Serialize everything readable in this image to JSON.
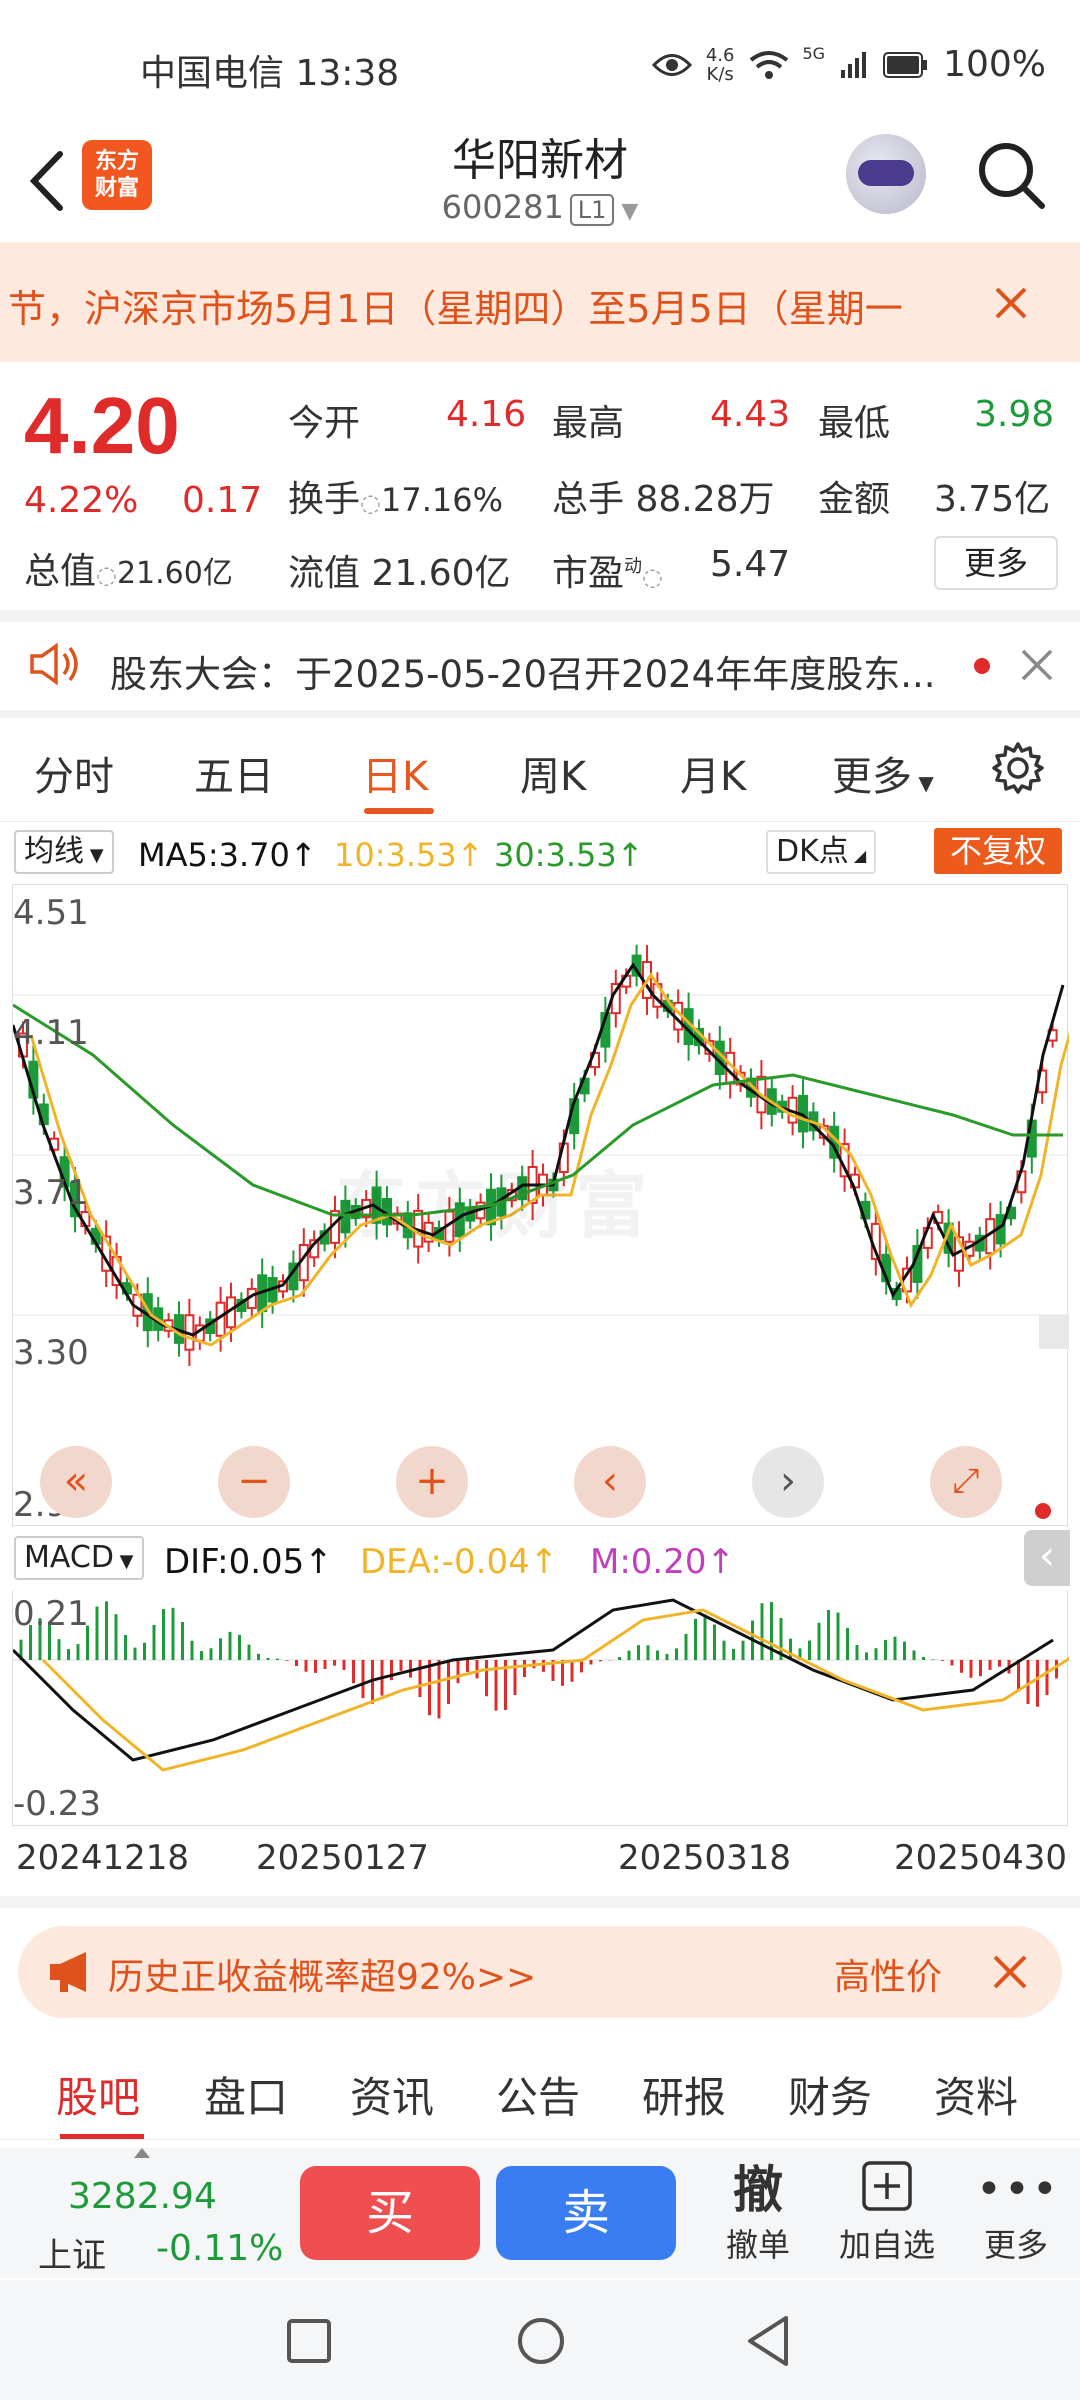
{
  "status_bar": {
    "carrier_time": "中国电信 13:38",
    "net_speed_value": "4.6",
    "net_speed_unit": "K/s",
    "signal": "5G",
    "battery": "100%"
  },
  "header": {
    "logo_text_1": "东方",
    "logo_text_2": "财富",
    "stock_name": "华阳新材",
    "stock_code": "600281",
    "level": "L1"
  },
  "notice": {
    "text": "节，沪深京市场5月1日（星期四）至5月5日（星期一"
  },
  "quote": {
    "price": "4.20",
    "change_pct": "4.22%",
    "change": "0.17",
    "market_value_label": "总值",
    "market_value": "21.60亿",
    "open_label": "今开",
    "open": "4.16",
    "high_label": "最高",
    "high": "4.43",
    "low_label": "最低",
    "low": "3.98",
    "turnover_label": "换手",
    "turnover": "17.16%",
    "volume_label": "总手",
    "volume": "88.28万",
    "amount_label": "金额",
    "amount": "3.75亿",
    "float_label": "流值",
    "float_value": "21.60亿",
    "pe_label": "市盈",
    "pe_sup": "动",
    "pe": "5.47",
    "more": "更多"
  },
  "meeting": {
    "text": "股东大会：于2025-05-20召开2024年年度股东..."
  },
  "tabs": [
    {
      "label": "分时"
    },
    {
      "label": "五日"
    },
    {
      "label": "日K"
    },
    {
      "label": "周K"
    },
    {
      "label": "月K"
    },
    {
      "label": "更多"
    }
  ],
  "indicators": {
    "ma_select": "均线",
    "ma5": "MA5:3.70↑",
    "ma10": "10:3.53↑",
    "ma30": "30:3.53↑",
    "dk": "DK点",
    "adjust": "不复权",
    "macd_select": "MACD",
    "dif": "DIF:0.05↑",
    "dea": "DEA:-0.04↑",
    "m": "M:0.20↑"
  },
  "colors": {
    "up": "#e02b2b",
    "down": "#1d9a3a",
    "ma5": "#111111",
    "ma10": "#f0b429",
    "ma30": "#2a9a2a",
    "accent": "#e8571e"
  },
  "chart_data": {
    "type": "candlestick",
    "y_ticks": [
      "4.51",
      "4.11",
      "3.71",
      "3.30",
      "2.90"
    ],
    "macd_ticks": [
      "0.21",
      "-0.23"
    ],
    "x_ticks": [
      "20241218",
      "20250127",
      "20250318",
      "20250430"
    ],
    "watermark": "东方财富",
    "ylim": [
      2.9,
      4.51
    ]
  },
  "chart_controls": {
    "zoom_out": "−",
    "zoom_in": "+",
    "prev": "‹",
    "next": "›"
  },
  "ad": {
    "text": "历史正收益概率超92%>>",
    "right": "高性价"
  },
  "subtabs": [
    {
      "label": "股吧"
    },
    {
      "label": "盘口"
    },
    {
      "label": "资讯"
    },
    {
      "label": "公告"
    },
    {
      "label": "研报"
    },
    {
      "label": "财务"
    },
    {
      "label": "资料"
    }
  ],
  "bottom_bar": {
    "index_value": "3282.94",
    "index_name": "上证",
    "index_change": "-0.11%",
    "buy": "买",
    "sell": "卖",
    "cancel_icon": "撤",
    "cancel": "撤单",
    "add_fav": "加自选",
    "more": "更多"
  }
}
